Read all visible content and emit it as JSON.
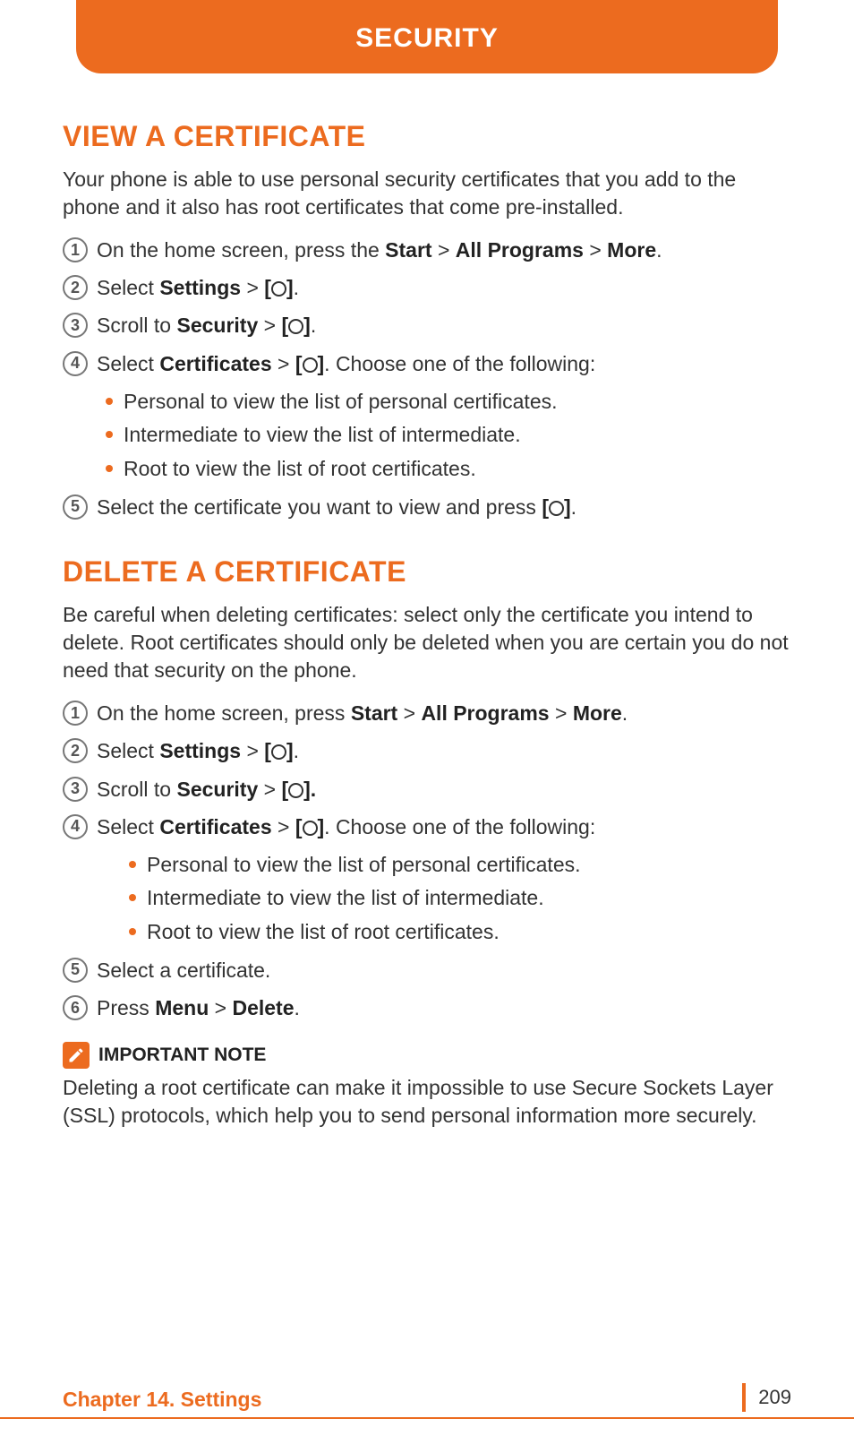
{
  "header": {
    "title": "SECURITY"
  },
  "sections": [
    {
      "title": "VIEW A CERTIFICATE",
      "intro": "Your phone is able to use personal security certificates that you add to the phone and it also has root certificates that come pre-installed.",
      "steps": [
        {
          "num": "1",
          "segments": [
            {
              "t": "On the home screen, press the "
            },
            {
              "t": "Start",
              "bold": true
            },
            {
              "t": " > "
            },
            {
              "t": "All Programs",
              "bold": true
            },
            {
              "t": " > "
            },
            {
              "t": "More",
              "bold": true
            },
            {
              "t": "."
            }
          ]
        },
        {
          "num": "2",
          "segments": [
            {
              "t": "Select "
            },
            {
              "t": "Settings",
              "bold": true
            },
            {
              "t": " > "
            },
            {
              "t": "[",
              "bold": true
            },
            {
              "icon": true
            },
            {
              "t": "]",
              "bold": true
            },
            {
              "t": "."
            }
          ]
        },
        {
          "num": "3",
          "segments": [
            {
              "t": "Scroll to "
            },
            {
              "t": "Security",
              "bold": true
            },
            {
              "t": " > "
            },
            {
              "t": "[",
              "bold": true
            },
            {
              "icon": true
            },
            {
              "t": "]",
              "bold": true
            },
            {
              "t": "."
            }
          ]
        },
        {
          "num": "4",
          "segments": [
            {
              "t": "Select "
            },
            {
              "t": "Certificates",
              "bold": true
            },
            {
              "t": " > "
            },
            {
              "t": "[",
              "bold": true
            },
            {
              "icon": true
            },
            {
              "t": "]",
              "bold": true
            },
            {
              "t": ". Choose one of the following:"
            }
          ],
          "bullets": [
            "Personal to view the list of personal certificates.",
            "Intermediate to view the list of intermediate.",
            "Root to view the list of root certificates."
          ]
        },
        {
          "num": "5",
          "segments": [
            {
              "t": "Select the certificate you want to view and press "
            },
            {
              "t": "[",
              "bold": true
            },
            {
              "icon": true
            },
            {
              "t": "]",
              "bold": true
            },
            {
              "t": "."
            }
          ]
        }
      ]
    },
    {
      "title": "DELETE A CERTIFICATE",
      "intro": "Be careful when deleting certificates: select only the certificate you intend to delete. Root certificates should only be deleted when you are certain you do not need that security on the phone.",
      "steps": [
        {
          "num": "1",
          "segments": [
            {
              "t": "On the home screen, press "
            },
            {
              "t": "Start",
              "bold": true
            },
            {
              "t": " > "
            },
            {
              "t": "All Programs",
              "bold": true
            },
            {
              "t": " > "
            },
            {
              "t": "More",
              "bold": true
            },
            {
              "t": "."
            }
          ]
        },
        {
          "num": "2",
          "segments": [
            {
              "t": "Select "
            },
            {
              "t": "Settings",
              "bold": true
            },
            {
              "t": " > "
            },
            {
              "t": "[",
              "bold": true
            },
            {
              "icon": true
            },
            {
              "t": "]",
              "bold": true
            },
            {
              "t": "."
            }
          ]
        },
        {
          "num": "3",
          "segments": [
            {
              "t": "Scroll to "
            },
            {
              "t": "Security",
              "bold": true
            },
            {
              "t": " > "
            },
            {
              "t": "[",
              "bold": true
            },
            {
              "icon": true
            },
            {
              "t": "].",
              "bold": true
            }
          ]
        },
        {
          "num": "4",
          "segments": [
            {
              "t": "Select "
            },
            {
              "t": "Certificates",
              "bold": true
            },
            {
              "t": " > "
            },
            {
              "t": "[",
              "bold": true
            },
            {
              "icon": true
            },
            {
              "t": "]",
              "bold": true
            },
            {
              "t": ". Choose one of the following:"
            }
          ],
          "indent": true,
          "bullets": [
            "Personal to view the list of personal certificates.",
            "Intermediate to view the list of intermediate.",
            "Root to view the list of root certificates."
          ]
        },
        {
          "num": "5",
          "segments": [
            {
              "t": "Select a certificate."
            }
          ]
        },
        {
          "num": "6",
          "segments": [
            {
              "t": "Press "
            },
            {
              "t": "Menu",
              "bold": true
            },
            {
              "t": " > "
            },
            {
              "t": "Delete",
              "bold": true
            },
            {
              "t": "."
            }
          ]
        }
      ]
    }
  ],
  "note": {
    "label": "IMPORTANT NOTE",
    "text": "Deleting a root certificate can make it impossible to use Secure Sockets Layer (SSL) protocols, which help you to send personal information more securely."
  },
  "footer": {
    "chapter": "Chapter 14. Settings",
    "page": "209"
  }
}
